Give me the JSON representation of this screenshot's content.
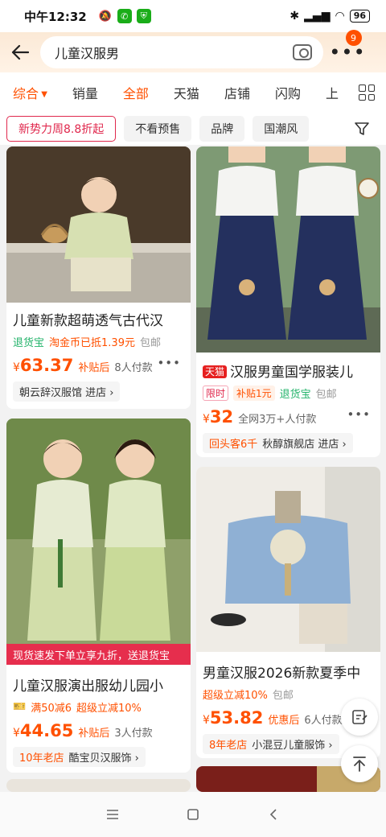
{
  "status_bar": {
    "time": "中午12:32",
    "battery": "96",
    "icons": [
      "mute-icon",
      "wechat-icon",
      "shield-icon",
      "bluetooth-icon",
      "signal-icon",
      "wifi-icon",
      "battery-icon"
    ]
  },
  "header": {
    "search_query": "儿童汉服男",
    "notification_count": "9"
  },
  "sort_tabs": [
    "综合",
    "销量",
    "全部",
    "天猫",
    "店铺",
    "闪购",
    "上"
  ],
  "filters": [
    "新势力周8.8折起",
    "不看预售",
    "品牌",
    "国潮风"
  ],
  "products": [
    {
      "title": "儿童新款超萌透气古代汉",
      "tag1": "退货宝",
      "tag2": "淘金币已抵1.39元",
      "tag3": "包邮",
      "currency": "¥",
      "price": "63.37",
      "price_label": "补贴后",
      "sales": "8人付款",
      "shop": "朝云辞汉服馆 进店 ›"
    },
    {
      "platform": "天猫",
      "title": "汉服男童国学服装儿",
      "tag_limited": "限时",
      "tag_subsidy": "补贴1元",
      "tag1": "退货宝",
      "tag2": "包邮",
      "currency": "¥",
      "price": "32",
      "sales": "全网3万+人付款",
      "shop_highlight": "回头客6千",
      "shop": "秋醇旗舰店 进店 ›"
    },
    {
      "banner": "现货速发下单立享九折，送退货宝",
      "title": "儿童汉服演出服幼儿园小",
      "tag1": "满50减6",
      "tag2": "超级立减10%",
      "currency": "¥",
      "price": "44.65",
      "price_label": "补贴后",
      "sales": "3人付款",
      "shop_highlight": "10年老店",
      "shop": "酷宝贝汉服饰 ›"
    },
    {
      "title": "男童汉服2026新款夏季中",
      "tag1": "超级立减10%",
      "tag2": "包邮",
      "currency": "¥",
      "price": "53.82",
      "price_label": "优惠后",
      "sales": "6人付款",
      "shop_highlight": "8年老店",
      "shop": "小混豆儿童服饰 ›"
    }
  ],
  "colors": {
    "accent": "#ff5000",
    "tmall": "#e62020",
    "green_tag": "#24b36b",
    "promo": "#e0284d"
  }
}
